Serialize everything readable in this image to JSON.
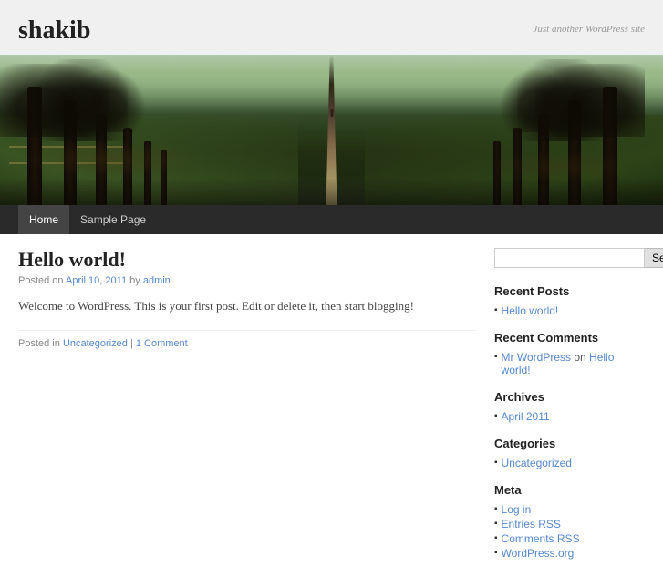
{
  "site": {
    "title": "shakib",
    "tagline": "Just another WordPress site"
  },
  "nav": {
    "items": [
      {
        "label": "Home",
        "active": true
      },
      {
        "label": "Sample Page",
        "active": false
      }
    ]
  },
  "post": {
    "title": "Hello world!",
    "meta_prefix": "Posted on",
    "date": "April 10, 2011",
    "author_prefix": "by",
    "author": "admin",
    "content": "Welcome to WordPress. This is your first post. Edit or delete it, then start blogging!",
    "footer_prefix": "Posted in",
    "category": "Uncategorized",
    "separator": "|",
    "comments": "1 Comment"
  },
  "sidebar": {
    "search": {
      "placeholder": "",
      "button_label": "Search"
    },
    "recent_posts": {
      "heading": "Recent Posts",
      "items": [
        {
          "label": "Hello world!"
        }
      ]
    },
    "recent_comments": {
      "heading": "Recent Comments",
      "items": [
        {
          "author": "Mr WordPress",
          "on": "on",
          "post": "Hello world!"
        }
      ]
    },
    "archives": {
      "heading": "Archives",
      "items": [
        {
          "label": "April 2011"
        }
      ]
    },
    "categories": {
      "heading": "Categories",
      "items": [
        {
          "label": "Uncategorized"
        }
      ]
    },
    "meta": {
      "heading": "Meta",
      "items": [
        {
          "label": "Log in"
        },
        {
          "label": "Entries RSS"
        },
        {
          "label": "Comments RSS"
        },
        {
          "label": "WordPress.org"
        }
      ]
    }
  }
}
